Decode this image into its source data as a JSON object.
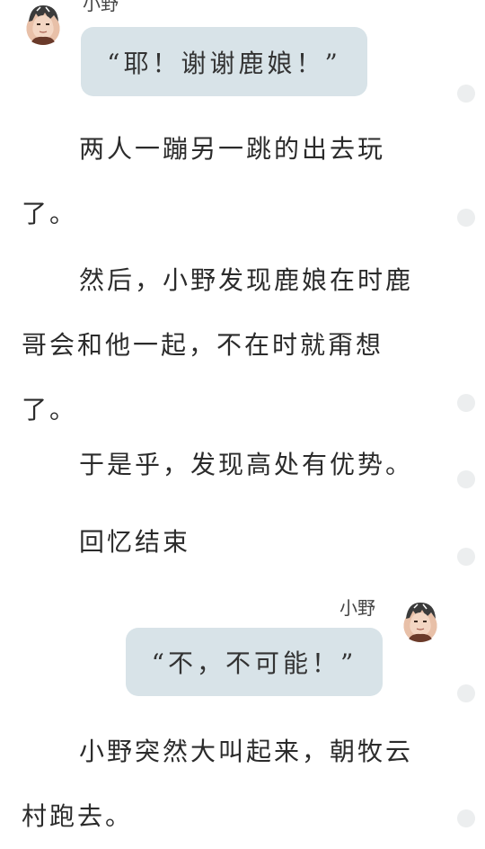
{
  "chat_top": {
    "speaker": "小野",
    "avatar_icon": "character-portrait-icon",
    "bubble_text": "“耶！谢谢鹿娘！”"
  },
  "paragraphs": [
    "两人一蹦另一跳的出去玩了。",
    "然后，小野发现鹿娘在时鹿哥会和他一起，不在时就甭想了。",
    "于是乎，发现高处有优势。",
    "回忆结束"
  ],
  "chat_middle": {
    "speaker": "小野",
    "avatar_icon": "character-portrait-icon",
    "bubble_text": "“不，不可能！”"
  },
  "paragraph_last": "小野突然大叫起来，朝牧云村跑去。",
  "colors": {
    "bubble_bg": "#d8e3e8",
    "dot": "#eceeef",
    "text": "#2b2b2b"
  },
  "side_markers": {
    "icon": "comment-dot-icon"
  }
}
